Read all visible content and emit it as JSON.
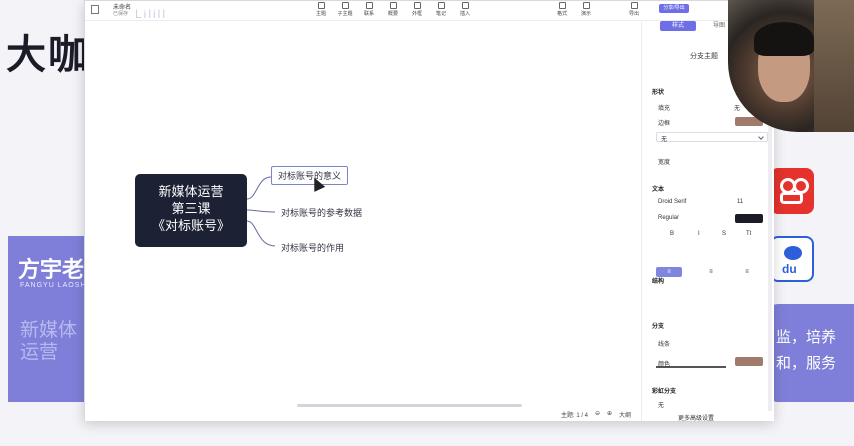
{
  "background": {
    "title": "大咖",
    "presenter_name": "方宇老师",
    "presenter_sub": "FANGYU LAOSHI",
    "purple_big": "新媒体运营",
    "right_block_lines": [
      "监，培养",
      "和，服务"
    ],
    "baidu_text": "du"
  },
  "toolbar": {
    "doc_name": "未命名",
    "doc_sub": "已保存",
    "blurred_title": "Lilill",
    "buttons": [
      "主题",
      "子主题",
      "联系",
      "概要",
      "外框",
      "笔记",
      "插入"
    ],
    "right_buttons": [
      "格式",
      "演示"
    ],
    "save_label": "分享/导出",
    "save_top": "导出"
  },
  "canvas": {
    "root_lines": [
      "新媒体运营",
      "第三课",
      "《对标账号》"
    ],
    "branches": [
      "对标账号的意义",
      "对标账号的参考数据",
      "对标账号的作用"
    ],
    "status": {
      "topics": "主题: 1 / 4",
      "zoom_in": "⊕",
      "zoom_out": "⊖",
      "size_label": "大纲"
    }
  },
  "panel": {
    "tabs": [
      "样式",
      "导图"
    ],
    "title": "分支主题",
    "sections": {
      "shape": "形状",
      "fill_label": "填充",
      "fill_value": "无",
      "border_label": "边框",
      "border_select": "无",
      "width_label": "宽度",
      "text": "文本",
      "font": "Droid Serif",
      "font_size": "11",
      "weight": "Regular",
      "align_b": "B",
      "align_i": "I",
      "align_s": "S",
      "align_t": "Tt",
      "branch": "分支",
      "branch_label": "分支",
      "line_label": "线条",
      "color_label": "颜色",
      "rainbow": "彩虹分支",
      "rainbow_value": "无",
      "more": "更多高级设置",
      "structure": "结构"
    },
    "colors": {
      "accent": "#6e6ee6",
      "swatch_border": "#a07a6a",
      "swatch_text": "#1c1c28",
      "swatch_color": "#a07a6a"
    }
  }
}
